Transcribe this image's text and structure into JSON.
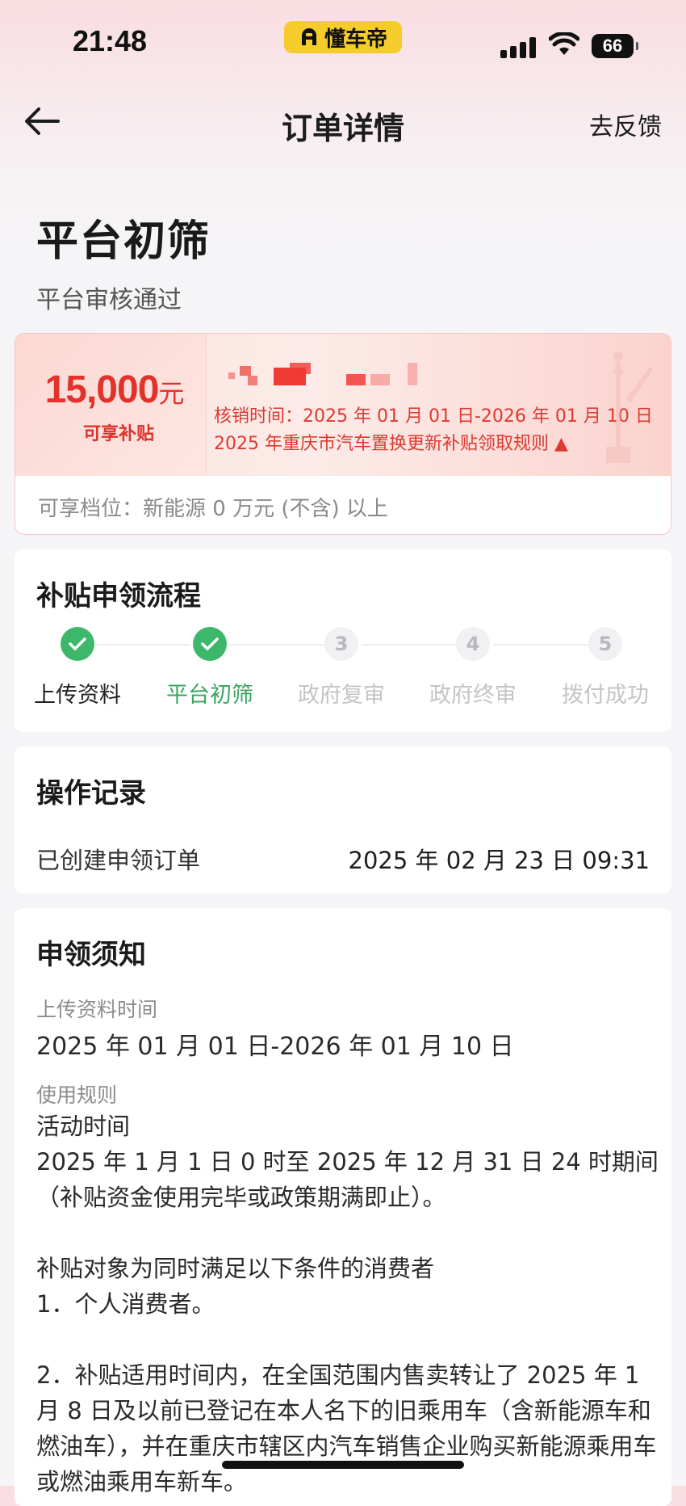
{
  "status_bar": {
    "time": "21:48",
    "app_name": "懂车帝",
    "battery": "66"
  },
  "nav": {
    "title": "订单详情",
    "feedback": "去反馈"
  },
  "order_status": {
    "title": "平台初筛",
    "subtitle": "平台审核通过"
  },
  "subsidy": {
    "amount": "15,000",
    "unit": "元",
    "amount_label": "可享补贴",
    "validity": "核销时间：2025 年 01 月 01 日-2026 年 01 月 10 日",
    "rules_link": "2025 年重庆市汽车置换更新补贴领取规则 ▲",
    "tier": "可享档位：新能源 0 万元 (不含) 以上",
    "accent_color": "#e2322b"
  },
  "process": {
    "title": "补贴申领流程",
    "steps": [
      {
        "label": "上传资料",
        "state": "done",
        "number": "1"
      },
      {
        "label": "平台初筛",
        "state": "current",
        "number": "2"
      },
      {
        "label": "政府复审",
        "state": "pending",
        "number": "3"
      },
      {
        "label": "政府终审",
        "state": "pending",
        "number": "4"
      },
      {
        "label": "拨付成功",
        "state": "pending",
        "number": "5"
      }
    ],
    "done_color": "#3db86b"
  },
  "records": {
    "title": "操作记录",
    "items": [
      {
        "action": "已创建申领订单",
        "time": "2025 年 02 月 23 日 09:31"
      }
    ]
  },
  "notice": {
    "title": "申领须知",
    "upload_label": "上传资料时间",
    "upload_value": "2025 年 01 月 01 日-2026 年 01 月 10 日",
    "rules_label": "使用规则",
    "rules_heading": "活动时间",
    "rules_period": "2025 年 1 月 1 日 0 时至 2025 年 12 月 31 日 24 时期间（补贴资金使用完毕或政策期满即止）。",
    "eligibility_intro": "补贴对象为同时满足以下条件的消费者",
    "condition_1": "1．个人消费者。",
    "condition_2": "2．补贴适用时间内，在全国范围内售卖转让了 2025 年 1 月 8 日及以前已登记在本人名下的旧乘用车（含新能源车和燃油车），并在重庆市辖区内汽车销售企业购买新能源乘用车或燃油乘用车新车。"
  }
}
